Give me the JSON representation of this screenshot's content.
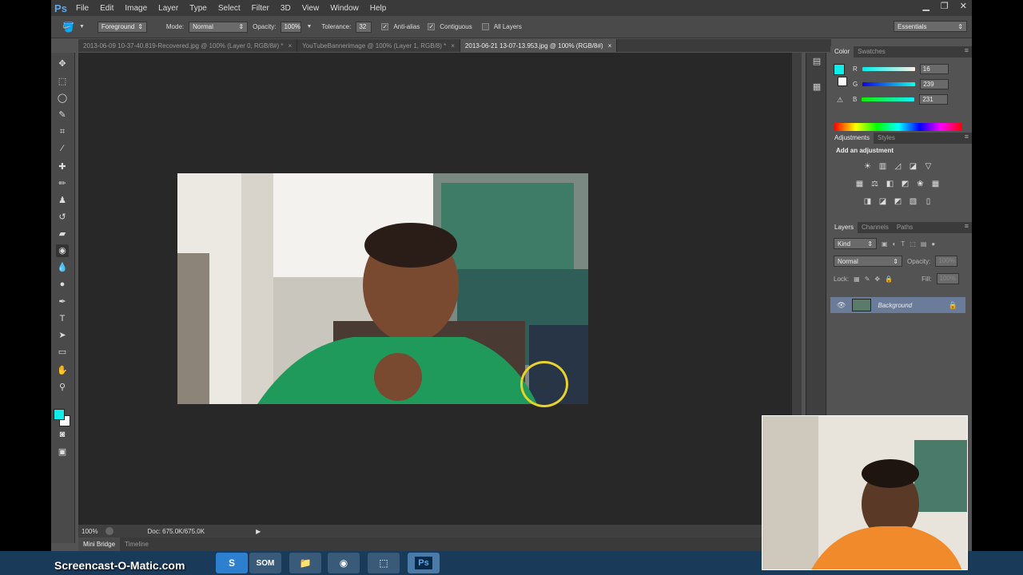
{
  "menu": {
    "logo": "Ps",
    "items": [
      "File",
      "Edit",
      "Image",
      "Layer",
      "Type",
      "Select",
      "Filter",
      "3D",
      "View",
      "Window",
      "Help"
    ]
  },
  "options": {
    "sample": "Foreground",
    "mode_label": "Mode:",
    "mode_value": "Normal",
    "opacity_label": "Opacity:",
    "opacity_value": "100%",
    "tolerance_label": "Tolerance:",
    "tolerance_value": "32",
    "anti_alias": "Anti-alias",
    "contiguous": "Contiguous",
    "all_layers": "All Layers",
    "workspace": "Essentials"
  },
  "tabs": [
    {
      "label": "2013-06-09 10-37-40.819-Recovered.jpg @ 100% (Layer 0, RGB/8#) *",
      "active": false
    },
    {
      "label": "YouTubeBannerimage @ 100% (Layer 1, RGB/8) *",
      "active": false
    },
    {
      "label": "2013-06-21 13-07-13.953.jpg @ 100% (RGB/8#)",
      "active": true
    }
  ],
  "status": {
    "zoom": "100%",
    "doc": "Doc: 675.0K/675.0K"
  },
  "bottom_tabs": [
    "Mini Bridge",
    "Timeline"
  ],
  "color_panel": {
    "tabs": [
      "Color",
      "Swatches"
    ],
    "r_label": "R",
    "g_label": "G",
    "b_label": "B",
    "r": "16",
    "g": "239",
    "b": "231",
    "foreground": "#10efe7"
  },
  "adjust_panel": {
    "tabs": [
      "Adjustments",
      "Styles"
    ],
    "title": "Add an adjustment"
  },
  "layers_panel": {
    "tabs": [
      "Layers",
      "Channels",
      "Paths"
    ],
    "kind": "Kind",
    "blend": "Normal",
    "opacity_label": "Opacity:",
    "opacity_value": "100%",
    "lock_label": "Lock:",
    "fill_label": "Fill:",
    "fill_value": "100%",
    "layer_name": "Background"
  },
  "taskbar": {
    "watermark": "Screencast-O-Matic.com",
    "som": "SOM",
    "ps": "Ps"
  }
}
